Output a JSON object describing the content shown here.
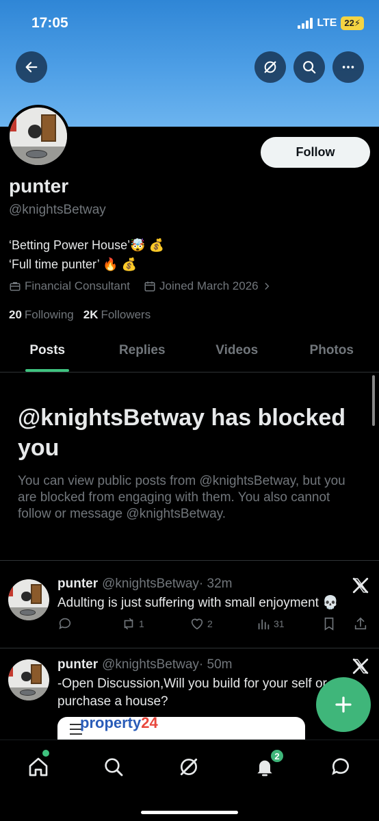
{
  "status_bar": {
    "time": "17:05",
    "network": "LTE",
    "battery": "22"
  },
  "profile": {
    "display_name": "punter",
    "handle": "@knightsBetway",
    "follow_label": "Follow",
    "bio_line1": "‘Betting Power House’🤯 💰",
    "bio_line2": "‘Full time punter’ 🔥 💰",
    "category": "Financial Consultant",
    "joined": "Joined March 2026",
    "following_count": "20",
    "following_label": "Following",
    "followers_count": "2K",
    "followers_label": "Followers"
  },
  "tabs": [
    {
      "label": "Posts",
      "active": true
    },
    {
      "label": "Replies",
      "active": false
    },
    {
      "label": "Videos",
      "active": false
    },
    {
      "label": "Photos",
      "active": false
    }
  ],
  "blocked": {
    "title": "@knightsBetway has blocked you",
    "description": "You can view public posts from @knightsBetway, but you are blocked from engaging with them. You also cannot follow or message @knightsBetway."
  },
  "posts": [
    {
      "name": "punter",
      "handle": "@knightsBetway",
      "time": "· 32m",
      "text": "Adulting is just suffering with small enjoyment 💀",
      "retweets": "1",
      "likes": "2",
      "views": "31"
    },
    {
      "name": "punter",
      "handle": "@knightsBetway",
      "time": "· 50m",
      "text": "-Open Discussion,Will you build for your self or purchase a house?"
    }
  ],
  "ad": {
    "brand_main": "property",
    "brand_num": "24"
  },
  "nav": {
    "notification_count": "2"
  },
  "colors": {
    "accent": "#3fb67a",
    "banner": "#4e9fe6",
    "muted": "#71767b"
  }
}
